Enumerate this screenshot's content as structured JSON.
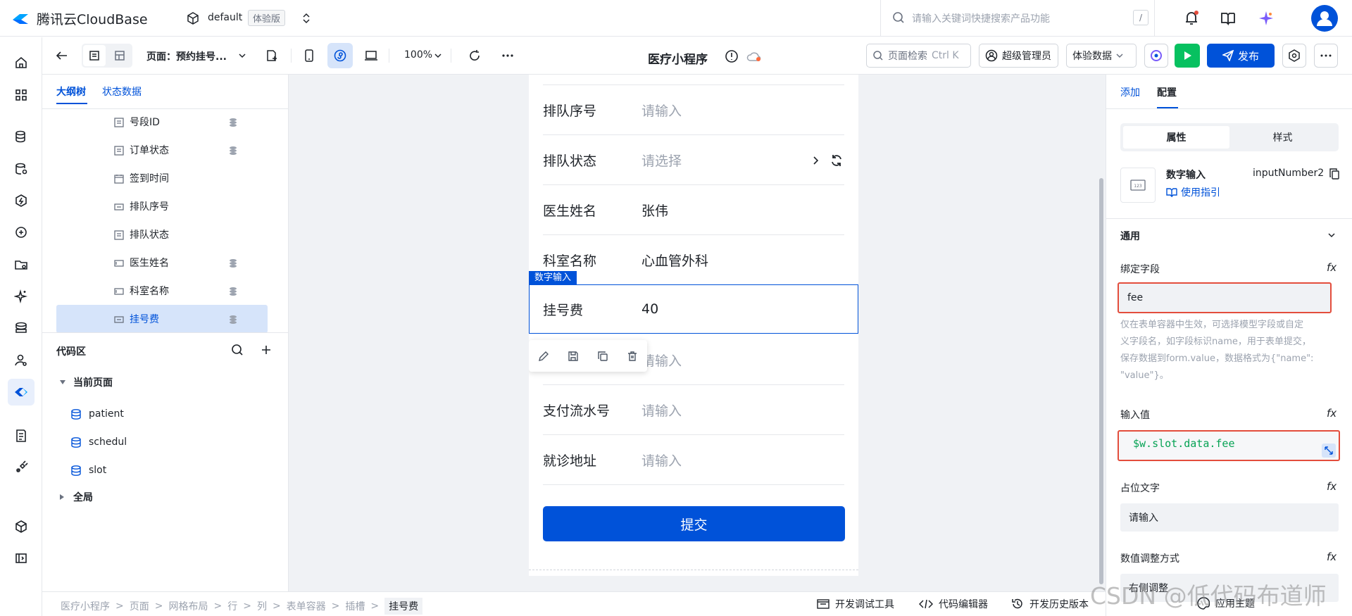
{
  "topbar": {
    "logo": "腾讯云CloudBase",
    "env_name": "default",
    "env_tag": "体验版",
    "search_placeholder": "请输入关键词快捷搜索产品功能",
    "search_shortcut": "/"
  },
  "toolbar": {
    "page_selector": "页面：预约挂号...",
    "zoom": "100%",
    "app_title": "医疗小程序",
    "page_search": "页面检索",
    "page_search_shortcut": "Ctrl K",
    "admin": "超级管理员",
    "data_mode": "体验数据",
    "publish": "发布"
  },
  "left_panel": {
    "tabs": [
      "大纲树",
      "状态数据"
    ],
    "tree_items": [
      {
        "label": "号段ID",
        "has_db": true
      },
      {
        "label": "订单状态",
        "has_db": true
      },
      {
        "label": "签到时间",
        "has_db": false
      },
      {
        "label": "排队序号",
        "has_db": false
      },
      {
        "label": "排队状态",
        "has_db": false
      },
      {
        "label": "医生姓名",
        "has_db": true
      },
      {
        "label": "科室名称",
        "has_db": true
      },
      {
        "label": "挂号费",
        "has_db": true
      }
    ],
    "code_area": {
      "title": "代码区",
      "current_page": "当前页面",
      "items": [
        "patient",
        "schedul",
        "slot"
      ],
      "global": "全局"
    }
  },
  "canvas": {
    "rows": [
      {
        "label": "排队序号",
        "value": "",
        "placeholder": "请输入"
      },
      {
        "label": "排队状态",
        "value": "",
        "placeholder": "请选择"
      },
      {
        "label": "医生姓名",
        "value": "张伟",
        "placeholder": ""
      },
      {
        "label": "科室名称",
        "value": "心血管外科",
        "placeholder": ""
      },
      {
        "label": "挂号费",
        "value": "40",
        "placeholder": ""
      },
      {
        "label": "",
        "value": "",
        "placeholder": "请输入"
      },
      {
        "label": "支付流水号",
        "value": "",
        "placeholder": "请输入"
      },
      {
        "label": "就诊地址",
        "value": "",
        "placeholder": "请输入"
      }
    ],
    "selected_tag": "数字输入",
    "submit": "提交"
  },
  "right_panel": {
    "tabs": [
      "添加",
      "配置"
    ],
    "segments": [
      "属性",
      "样式"
    ],
    "component_name": "数字输入",
    "component_id": "inputNumber2",
    "guide_link": "使用指引",
    "section": "通用",
    "bind_field_label": "绑定字段",
    "bind_field_value": "fee",
    "bind_hint_1": "仅在表单容器中生效，可选择模型字段或自定",
    "bind_hint_2": "义字段名，如字段标识name，用于表单提交，",
    "bind_hint_3": "保存数据到form.value，数据格式为{\"name\":",
    "bind_hint_4": "\"value\"}。",
    "input_value_label": "输入值",
    "input_value": "$w.slot.data.fee",
    "placeholder_label": "占位文字",
    "placeholder_value": "请输入",
    "adjust_label": "数值调整方式",
    "adjust_value": "右侧调整",
    "fx": "fx"
  },
  "bottombar": {
    "breadcrumb": [
      "医疗小程序",
      "页面",
      "网格布局",
      "行",
      "列",
      "表单容器",
      "插槽",
      "挂号费"
    ],
    "tools": [
      "开发调试工具",
      "代码编辑器",
      "开发历史版本",
      "应用主题"
    ]
  },
  "watermark": "CSDN @低代码布道师",
  "colors": {
    "primary": "#0052d9",
    "run": "#07c160",
    "highlight": "#e34d3c",
    "code": "#07a355"
  }
}
